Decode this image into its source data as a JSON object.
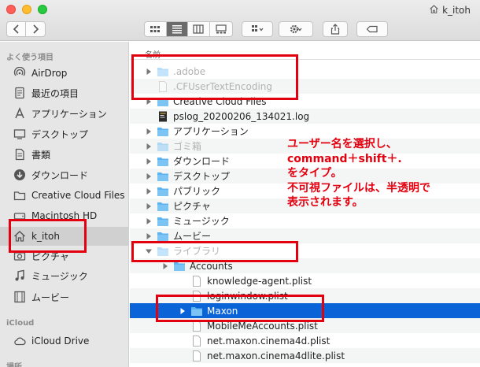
{
  "window": {
    "title": "k_itoh"
  },
  "sidebar": {
    "sections": [
      {
        "label": "よく使う項目"
      },
      {
        "label": "iCloud"
      },
      {
        "label": "場所"
      }
    ],
    "items": [
      {
        "label": "AirDrop",
        "icon": "airdrop-icon"
      },
      {
        "label": "最近の項目",
        "icon": "recents-icon"
      },
      {
        "label": "アプリケーション",
        "icon": "applications-icon"
      },
      {
        "label": "デスクトップ",
        "icon": "desktop-icon"
      },
      {
        "label": "書類",
        "icon": "documents-icon"
      },
      {
        "label": "ダウンロード",
        "icon": "downloads-icon"
      },
      {
        "label": "Creative Cloud Files",
        "icon": "folder-icon"
      },
      {
        "label": "Macintosh HD",
        "icon": "hard-drive-icon"
      },
      {
        "label": "k_itoh",
        "icon": "home-icon"
      },
      {
        "label": "ピクチャ",
        "icon": "camera-icon"
      },
      {
        "label": "ミュージック",
        "icon": "music-note-icon"
      },
      {
        "label": "ムービー",
        "icon": "film-icon"
      },
      {
        "label": "iCloud Drive",
        "icon": "cloud-icon"
      }
    ]
  },
  "list": {
    "column_name": "名前",
    "rows": [
      {
        "name": ".adobe",
        "kind": "folder",
        "hidden": true,
        "expandable": true,
        "indent": 0
      },
      {
        "name": ".CFUserTextEncoding",
        "kind": "file",
        "hidden": true,
        "expandable": false,
        "indent": 0
      },
      {
        "name": "Creative Cloud Files",
        "kind": "folder",
        "hidden": false,
        "expandable": true,
        "indent": 0
      },
      {
        "name": "pslog_20200206_134021.log",
        "kind": "log",
        "hidden": false,
        "expandable": false,
        "indent": 0
      },
      {
        "name": "アプリケーション",
        "kind": "folder",
        "hidden": false,
        "expandable": true,
        "indent": 0
      },
      {
        "name": "ゴミ箱",
        "kind": "folder",
        "hidden": true,
        "expandable": true,
        "indent": 0
      },
      {
        "name": "ダウンロード",
        "kind": "folder",
        "hidden": false,
        "expandable": true,
        "indent": 0
      },
      {
        "name": "デスクトップ",
        "kind": "folder",
        "hidden": false,
        "expandable": true,
        "indent": 0
      },
      {
        "name": "パブリック",
        "kind": "folder",
        "hidden": false,
        "expandable": true,
        "indent": 0
      },
      {
        "name": "ピクチャ",
        "kind": "folder",
        "hidden": false,
        "expandable": true,
        "indent": 0
      },
      {
        "name": "ミュージック",
        "kind": "folder",
        "hidden": false,
        "expandable": true,
        "indent": 0
      },
      {
        "name": "ムービー",
        "kind": "folder",
        "hidden": false,
        "expandable": true,
        "indent": 0
      },
      {
        "name": "ライブラリ",
        "kind": "folder",
        "hidden": true,
        "expandable": true,
        "expanded": true,
        "indent": 0
      },
      {
        "name": "Accounts",
        "kind": "folder",
        "hidden": false,
        "expandable": true,
        "indent": 1
      },
      {
        "name": "knowledge-agent.plist",
        "kind": "file",
        "hidden": false,
        "expandable": false,
        "indent": 2
      },
      {
        "name": "loginwindow.plist",
        "kind": "file",
        "hidden": false,
        "expandable": false,
        "indent": 2
      },
      {
        "name": "Maxon",
        "kind": "folder",
        "hidden": false,
        "expandable": true,
        "selected": true,
        "indent": 2
      },
      {
        "name": "MobileMeAccounts.plist",
        "kind": "file",
        "hidden": false,
        "expandable": false,
        "indent": 2
      },
      {
        "name": "net.maxon.cinema4d.plist",
        "kind": "file",
        "hidden": false,
        "expandable": false,
        "indent": 2
      },
      {
        "name": "net.maxon.cinema4dlite.plist",
        "kind": "file",
        "hidden": false,
        "expandable": false,
        "indent": 2
      }
    ]
  },
  "annotation": {
    "lines": [
      "ユーザー名を選択し、",
      "command＋shift＋.",
      "をタイプ。",
      "不可視ファイルは、半透明で",
      "表示されます。"
    ],
    "color": "#e3000f"
  },
  "colors": {
    "selection": "#0a64d8",
    "annotation_red": "#e3000f",
    "folder_blue": "#5db3f0"
  }
}
